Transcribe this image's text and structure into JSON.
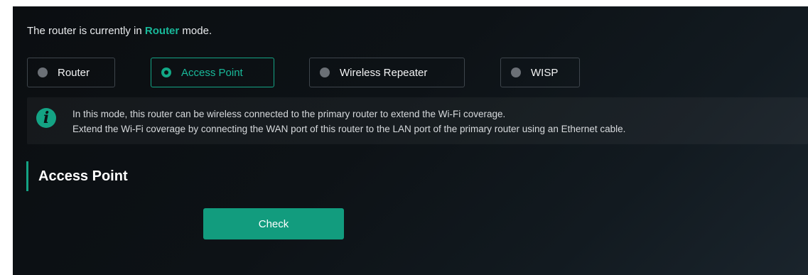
{
  "status": {
    "prefix": "The router is currently in ",
    "mode": "Router",
    "suffix": " mode."
  },
  "modes": [
    {
      "label": "Router",
      "selected": false
    },
    {
      "label": "Access Point",
      "selected": true
    },
    {
      "label": "Wireless Repeater",
      "selected": false
    },
    {
      "label": "WISP",
      "selected": false
    }
  ],
  "info": {
    "line1": "In this mode, this router can be wireless connected to the primary router to extend the Wi-Fi coverage.",
    "line2": "Extend the Wi-Fi coverage by connecting the WAN port of this router to the LAN port of the primary router using an Ethernet cable."
  },
  "section": {
    "title": "Access Point"
  },
  "actions": {
    "check_label": "Check"
  },
  "colors": {
    "accent": "#14a384",
    "background": "#0d1216"
  },
  "icons": {
    "info": "info-icon",
    "radio": "radio-icon"
  }
}
